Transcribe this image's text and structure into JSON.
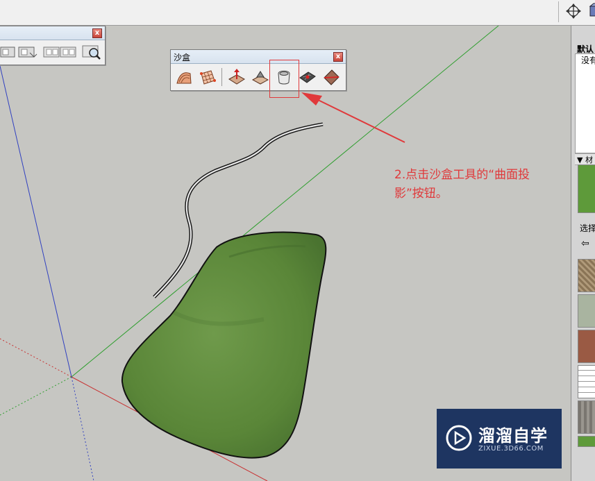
{
  "sandbox_toolbar": {
    "title": "沙盒",
    "close_label": "x",
    "tools": [
      {
        "name": "From Contours",
        "icon": "sandbox-from-contours-icon"
      },
      {
        "name": "From Scratch",
        "icon": "sandbox-from-scratch-icon"
      },
      {
        "name": "Smoove",
        "icon": "sandbox-smoove-icon"
      },
      {
        "name": "Stamp",
        "icon": "sandbox-stamp-icon"
      },
      {
        "name": "Drape",
        "icon": "sandbox-drape-icon",
        "highlighted": true
      },
      {
        "name": "Add Detail",
        "icon": "sandbox-add-detail-icon"
      },
      {
        "name": "Flip Edge",
        "icon": "sandbox-flip-edge-icon"
      }
    ]
  },
  "left_toolbar": {
    "close_label": "x",
    "tools": [
      "view-tool-icon",
      "view-tool-icon",
      "view-tool-icon",
      "view-tool-icon",
      "zoom-extents-icon"
    ]
  },
  "annotation": {
    "line1": "2.点击沙盒工具的“曲面投",
    "line2": "影”按钮。"
  },
  "right_panel": {
    "title": "默认",
    "subtitle": "没有",
    "section_label": "▼ 材",
    "select_label": "选择",
    "back_arrow": "⇦"
  },
  "watermark": {
    "brand": "溜溜自学",
    "url": "ZIXUE.3D66.COM"
  },
  "colors": {
    "terrain": "#5e8a3e",
    "annotation": "#e0393b",
    "axis_green": "#2e9e2e",
    "axis_blue": "#3040c0",
    "axis_red": "#c83030",
    "watermark_bg": "#1e3561"
  }
}
